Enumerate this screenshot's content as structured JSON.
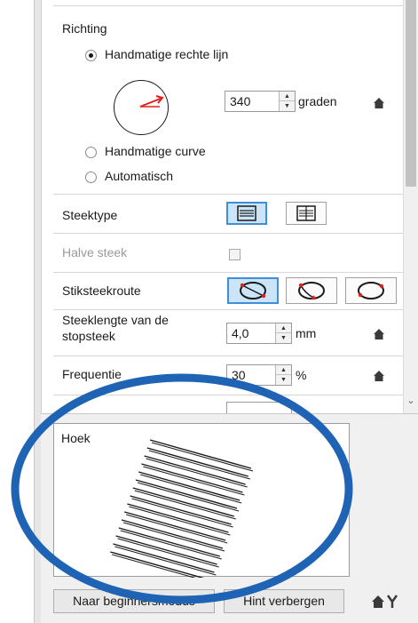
{
  "direction": {
    "label": "Richting",
    "options": [
      {
        "label": "Handmatige rechte lijn",
        "checked": true
      },
      {
        "label": "Handmatige curve",
        "checked": false
      },
      {
        "label": "Automatisch",
        "checked": false
      }
    ],
    "angle_value": "340",
    "angle_unit": "graden"
  },
  "properties": {
    "stitch_type_label": "Steektype",
    "half_stitch_label": "Halve steek",
    "route_label": "Stiksteekroute",
    "length_label_line1": "Steeklengte van de",
    "length_label_line2": "stopsteek",
    "length_value": "4,0",
    "length_unit": "mm",
    "frequency_label": "Frequentie",
    "frequency_value": "30",
    "frequency_unit": "%"
  },
  "hint": {
    "title": "Hoek"
  },
  "footer": {
    "beginner_button": "Naar beginnersmodus",
    "hide_hint_button": "Hint verbergen"
  },
  "colors": {
    "accent": "#3f8ed8",
    "toggle_active_bg": "#cce4f7",
    "annotation_circle": "#1f63b4",
    "dial_arrow": "#e0201b"
  },
  "icons": [
    "house-icon",
    "horizontal-lines-icon",
    "tie-lines-icon",
    "route-icon",
    "spin-up-icon",
    "spin-down-icon",
    "settings-icon"
  ]
}
